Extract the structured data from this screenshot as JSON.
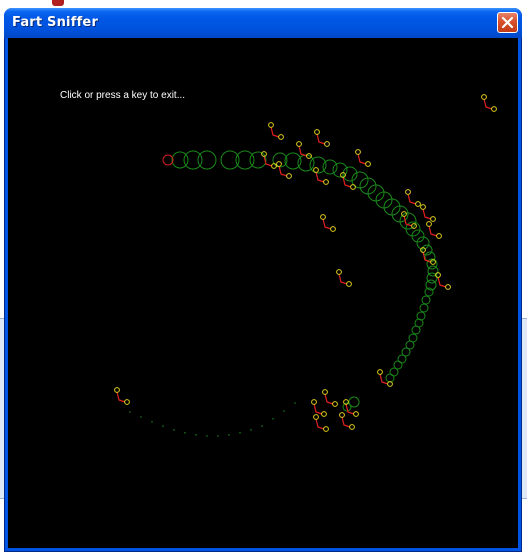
{
  "window": {
    "title": "Fart Sniffer",
    "close_icon": "close-x-icon"
  },
  "canvas": {
    "instruction": "Click or press a key to exit...",
    "colors": {
      "background": "#000000",
      "trail": "#1a8a1a",
      "trail_head": "#d42020",
      "sniffer_leg": "#e02020",
      "sniffer_joint": "#e0d020",
      "dust": "#1c7a1c"
    }
  }
}
